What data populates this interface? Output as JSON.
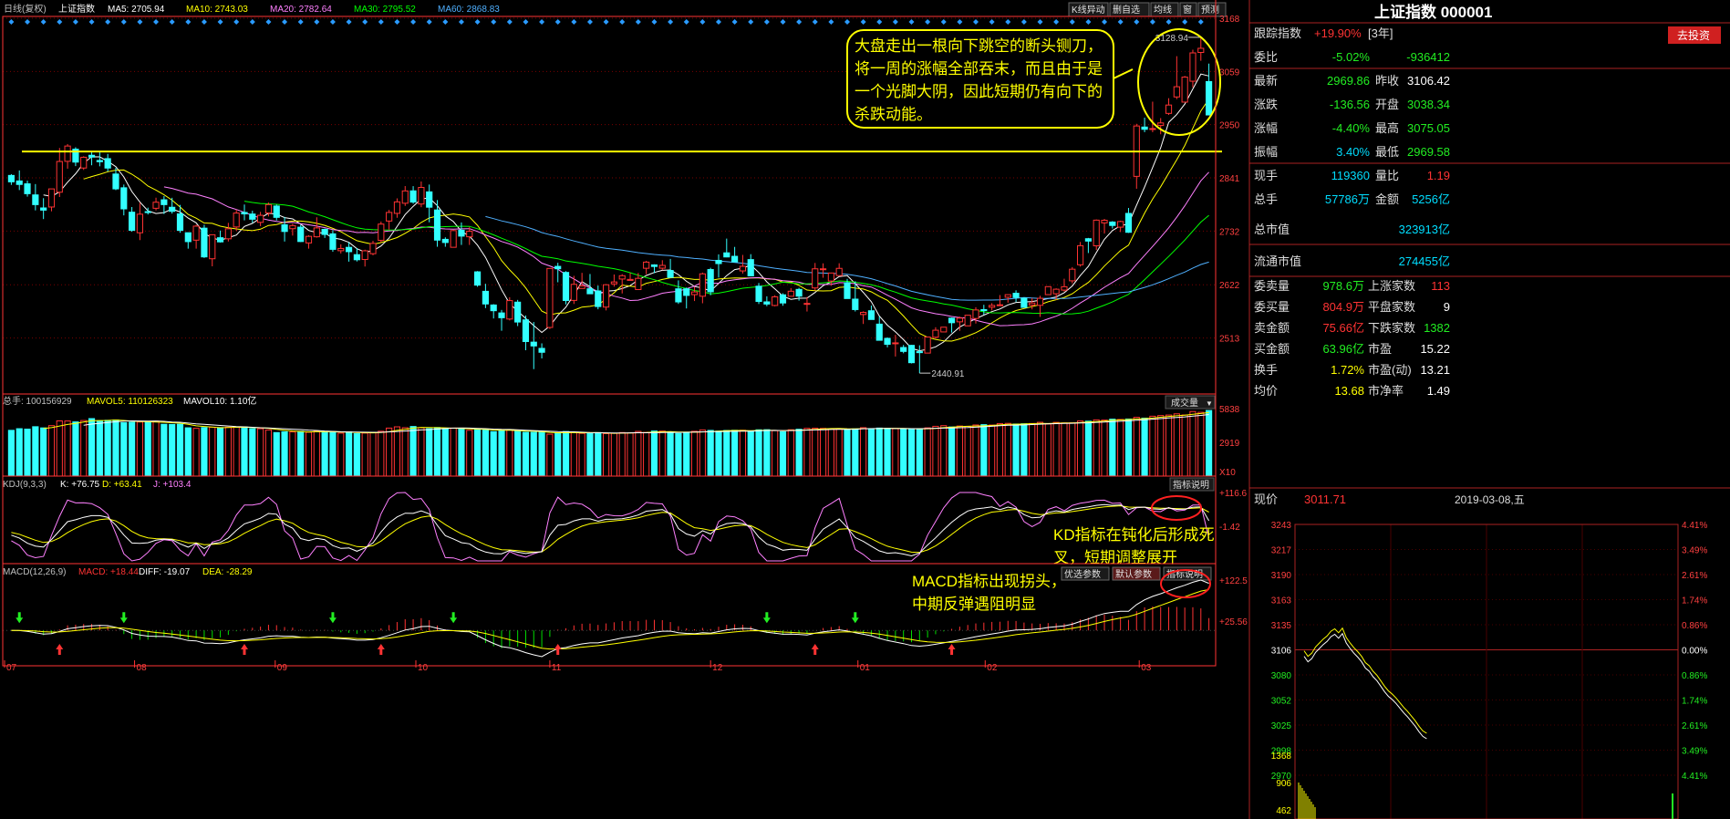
{
  "colors": {
    "up": "#ff3333",
    "down": "#33ffff",
    "ma5": "#ffffff",
    "ma10": "#ffff00",
    "ma20": "#ff80ff",
    "ma30": "#00ff00",
    "ma60": "#4fb0ff",
    "yellow": "#ffff00",
    "grid": "#7a0000",
    "axis": "#ff3333"
  },
  "header": {
    "title": "日线(复权)",
    "name": "上证指数",
    "ma5": "MA5: 2705.94",
    "ma10": "MA10: 2743.03",
    "ma20": "MA20: 2782.64",
    "ma30": "MA30: 2795.52",
    "ma60": "MA60: 2868.83",
    "buttons": [
      "K线异动",
      "删自选",
      "均线",
      "窗",
      "预测"
    ]
  },
  "price_annotation": "大盘走出一根向下跳空的断头铡刀，将一周的涨幅全部吞末，而且由于是一个光脚大阴，因此短期仍有向下的杀跌动能。",
  "kd_annotation": "KD指标在钝化后形成死叉，短期调整展开",
  "macd_annotation": "MACD指标出现拐头，中期反弹遇阻明显",
  "volume_panel": {
    "header": "总手: 100156929",
    "mavol5": "MAVOL5: 110126323",
    "mavol10": "MAVOL10: 1.10亿",
    "button": "成交量",
    "axis": [
      "5838",
      "2919",
      "X10"
    ]
  },
  "kdj_panel": {
    "header": "KDJ(9,3,3)",
    "k": "K: +76.75",
    "d": "D: +63.41",
    "j": "J: +103.4",
    "button": "指标说明",
    "axis": [
      "+116.6",
      "-1.42"
    ]
  },
  "macd_panel": {
    "header": "MACD(12,26,9)",
    "macd": "MACD: +18.44",
    "diff": "DIFF: -19.07",
    "dea": "DEA: -28.29",
    "buttons": [
      "优选参数",
      "默认参数",
      "指标说明"
    ],
    "axis": [
      "+122.5",
      "+25.56"
    ]
  },
  "x_labels": [
    "07",
    "08",
    "09",
    "10",
    "11",
    "12",
    "01",
    "02",
    "03"
  ],
  "right_panel": {
    "title": "上证指数 000001",
    "track_label": "跟踪指数",
    "track_value": "+19.90%",
    "track_period": "[3年]",
    "invest_button": "去投资",
    "rows": [
      [
        "委比",
        "-5.02%",
        "",
        "-936412"
      ],
      [
        "最新",
        "2969.86",
        "昨收",
        "3106.42"
      ],
      [
        "涨跌",
        "-136.56",
        "开盘",
        "3038.34"
      ],
      [
        "涨幅",
        "-4.40%",
        "最高",
        "3075.05"
      ],
      [
        "振幅",
        "3.40%",
        "最低",
        "2969.58"
      ],
      [
        "现手",
        "119360",
        "量比",
        "1.19"
      ],
      [
        "总手",
        "57786万",
        "金额",
        "5256亿"
      ]
    ],
    "cap_rows": [
      [
        "总市值",
        "323913亿"
      ],
      [
        "流通市值",
        "274455亿"
      ]
    ],
    "stat_rows": [
      [
        "委卖量",
        "978.6万",
        "上涨家数",
        "113"
      ],
      [
        "委买量",
        "804.9万",
        "平盘家数",
        "9"
      ],
      [
        "卖金额",
        "75.66亿",
        "下跌家数",
        "1382"
      ],
      [
        "买金额",
        "63.96亿",
        "市盈",
        "15.22"
      ],
      [
        "换手",
        "1.72%",
        "市盈(动)",
        "13.21"
      ],
      [
        "均价",
        "13.68",
        "市净率",
        "1.49"
      ]
    ]
  },
  "intraday": {
    "price_label": "现价",
    "price": "3011.71",
    "date": "2019-03-08,五",
    "left_axis": [
      "3243",
      "3217",
      "3190",
      "3163",
      "3135",
      "3106",
      "3080",
      "3052",
      "3025",
      "2998",
      "2970"
    ],
    "right_axis": [
      "4.41%",
      "3.49%",
      "2.61%",
      "1.74%",
      "0.86%",
      "0.00%",
      "0.86%",
      "1.74%",
      "2.61%",
      "3.49%",
      "4.41%"
    ],
    "vol_axis": [
      "1368",
      "906",
      "462"
    ]
  },
  "chart_data": {
    "type": "candlestick",
    "y_axis": [
      3168,
      3059,
      2950,
      2841,
      2732,
      2622,
      2513
    ],
    "ylim": [
      2402,
      3168
    ],
    "high_label": "3128.94",
    "low_label": "2440.91",
    "support_line": 2895,
    "ma_periods": [
      5,
      10,
      20,
      30,
      60
    ],
    "ohlc": [
      [
        2846.0,
        2848.6,
        2826.6,
        2832.9
      ],
      [
        2834.7,
        2856.2,
        2816.0,
        2827.5
      ],
      [
        2828.8,
        2835.3,
        2802.6,
        2808.6
      ],
      [
        2806.1,
        2828.3,
        2774.4,
        2786.2
      ],
      [
        2779.4,
        2799.4,
        2756.6,
        2774.9
      ],
      [
        2781.3,
        2818.4,
        2772.5,
        2818.4
      ],
      [
        2811.6,
        2902.2,
        2801.8,
        2874.6
      ],
      [
        2874.9,
        2910.3,
        2859.8,
        2906.2
      ],
      [
        2899.8,
        2903.7,
        2865.1,
        2873.3
      ],
      [
        2861.2,
        2885.3,
        2857.3,
        2883.2
      ],
      [
        2887.3,
        2893.3,
        2866.8,
        2883.5
      ],
      [
        2876.6,
        2894.2,
        2864.7,
        2874.1
      ],
      [
        2880.4,
        2890.1,
        2854.1,
        2861.1
      ],
      [
        2848.9,
        2861.8,
        2815.9,
        2818.5
      ],
      [
        2820.7,
        2827.3,
        2764.2,
        2777.5
      ],
      [
        2770.7,
        2781.3,
        2730.6,
        2733.5
      ],
      [
        2728.6,
        2790.3,
        2713.5,
        2766.6
      ],
      [
        2771.8,
        2780.0,
        2766.0,
        2771.5
      ],
      [
        2778.7,
        2800.4,
        2774.4,
        2791.1
      ],
      [
        2796.1,
        2803.6,
        2767.0,
        2786.2
      ],
      [
        2780.8,
        2800.2,
        2767.8,
        2772.4
      ],
      [
        2767.3,
        2785.6,
        2728.6,
        2733.4
      ],
      [
        2728.6,
        2727.2,
        2696.0,
        2710.4
      ],
      [
        2713.4,
        2745.2,
        2696.0,
        2742.1
      ],
      [
        2738.0,
        2745.0,
        2677.0,
        2679.1
      ],
      [
        2675.3,
        2724.9,
        2659.8,
        2724.5
      ],
      [
        2718.4,
        2733.1,
        2708.5,
        2709.9
      ],
      [
        2716.2,
        2748.8,
        2710.7,
        2736.7
      ],
      [
        2740.4,
        2776.0,
        2732.6,
        2768.9
      ],
      [
        2770.2,
        2786.4,
        2754.0,
        2767.2
      ],
      [
        2766.9,
        2773.7,
        2748.8,
        2756.3
      ],
      [
        2749.9,
        2771.3,
        2742.1,
        2764.3
      ],
      [
        2769.1,
        2790.5,
        2762.0,
        2786.2
      ],
      [
        2783.3,
        2786.4,
        2753.8,
        2760.1
      ],
      [
        2744.9,
        2761.0,
        2710.6,
        2731.2
      ],
      [
        2736.9,
        2747.0,
        2722.8,
        2743.3
      ],
      [
        2740.0,
        2744.8,
        2709.6,
        2710.6
      ],
      [
        2707.7,
        2723.3,
        2696.0,
        2721.2
      ],
      [
        2720.3,
        2760.3,
        2718.6,
        2738.5
      ],
      [
        2735.5,
        2737.2,
        2718.0,
        2725.1
      ],
      [
        2726.3,
        2733.7,
        2689.7,
        2694.6
      ],
      [
        2691.8,
        2704.9,
        2686.1,
        2696.4
      ],
      [
        2698.7,
        2709.1,
        2669.4,
        2689.8
      ],
      [
        2683.7,
        2697.2,
        2669.7,
        2673.3
      ],
      [
        2673.8,
        2693.9,
        2659.4,
        2691.6
      ],
      [
        2685.7,
        2712.1,
        2682.4,
        2706.8
      ],
      [
        2713.0,
        2751.5,
        2709.0,
        2746.3
      ],
      [
        2752.6,
        2775.4,
        2735.0,
        2770.2
      ],
      [
        2768.3,
        2799.0,
        2759.3,
        2791.8
      ],
      [
        2789.0,
        2824.2,
        2783.5,
        2814.3
      ],
      [
        2814.4,
        2824.0,
        2788.0,
        2791.4
      ],
      [
        2787.5,
        2833.6,
        2780.9,
        2821.4
      ],
      [
        2812.3,
        2827.3,
        2750.0,
        2780.9
      ],
      [
        2775.3,
        2795.5,
        2699.9,
        2713.5
      ],
      [
        2715.1,
        2719.2,
        2699.9,
        2708.6
      ],
      [
        2698.8,
        2734.5,
        2699.0,
        2733.0
      ],
      [
        2733.8,
        2749.7,
        2703.6,
        2721.7
      ],
      [
        2720.3,
        2740.0,
        2703.6,
        2731.6
      ],
      [
        2648.5,
        2650.1,
        2617.9,
        2621.3
      ],
      [
        2608.6,
        2624.0,
        2574.2,
        2582.7
      ],
      [
        2580.6,
        2582.3,
        2553.0,
        2568.9
      ],
      [
        2564.3,
        2570.5,
        2527.8,
        2554.5
      ],
      [
        2551.8,
        2596.5,
        2549.0,
        2589.6
      ],
      [
        2586.4,
        2591.0,
        2537.4,
        2545.7
      ],
      [
        2550.1,
        2559.1,
        2487.9,
        2505.7
      ],
      [
        2504.5,
        2545.7,
        2449.2,
        2496.7
      ],
      [
        2491.7,
        2502.0,
        2471.1,
        2483.7
      ],
      [
        2534.6,
        2655.5,
        2531.5,
        2655.5
      ],
      [
        2659.7,
        2667.0,
        2627.1,
        2654.8
      ],
      [
        2647.3,
        2649.9,
        2581.7,
        2589.8
      ],
      [
        2590.0,
        2640.2,
        2582.7,
        2622.9
      ],
      [
        2614.5,
        2646.4,
        2614.5,
        2619.6
      ],
      [
        2613.8,
        2644.1,
        2603.0,
        2603.6
      ],
      [
        2609.4,
        2620.4,
        2571.8,
        2577.4
      ],
      [
        2576.3,
        2623.5,
        2569.5,
        2622.0
      ],
      [
        2623.9,
        2643.1,
        2618.2,
        2627.8
      ],
      [
        2633.8,
        2643.7,
        2604.2,
        2640.6
      ],
      [
        2631.0,
        2646.2,
        2633.0,
        2633.0
      ],
      [
        2612.2,
        2646.2,
        2611.7,
        2635.2
      ],
      [
        2655.8,
        2670.9,
        2643.6,
        2668.4
      ],
      [
        2662.7,
        2664.0,
        2645.8,
        2659.5
      ],
      [
        2656.0,
        2672.3,
        2652.0,
        2661.7
      ],
      [
        2651.3,
        2675.0,
        2636.7,
        2637.2
      ],
      [
        2613.7,
        2631.0,
        2582.8,
        2586.9
      ],
      [
        2613.6,
        2616.4,
        2573.5,
        2600.2
      ],
      [
        2601.8,
        2617.6,
        2588.7,
        2607.3
      ],
      [
        2598.5,
        2647.0,
        2584.1,
        2644.4
      ],
      [
        2653.2,
        2656.8,
        2600.6,
        2607.6
      ],
      [
        2672.0,
        2684.3,
        2636.8,
        2665.4
      ],
      [
        2687.4,
        2716.6,
        2678.3,
        2679.0
      ],
      [
        2680.3,
        2699.6,
        2669.0,
        2669.0
      ],
      [
        2650.4,
        2683.2,
        2645.0,
        2659.8
      ],
      [
        2673.6,
        2684.7,
        2640.2,
        2640.2
      ],
      [
        2619.1,
        2625.7,
        2582.6,
        2587.8
      ],
      [
        2587.0,
        2598.4,
        2578.1,
        2582.5
      ],
      [
        2579.6,
        2600.6,
        2577.8,
        2597.3
      ],
      [
        2601.4,
        2604.5,
        2579.0,
        2584.7
      ],
      [
        2598.4,
        2615.2,
        2598.9,
        2608.8
      ],
      [
        2612.5,
        2615.8,
        2589.5,
        2598.7
      ],
      [
        2583.6,
        2597.0,
        2567.2,
        2583.8
      ],
      [
        2615.5,
        2666.7,
        2610.2,
        2654.7
      ],
      [
        2654.0,
        2665.9,
        2636.4,
        2654.7
      ],
      [
        2629.7,
        2646.9,
        2619.9,
        2646.1
      ],
      [
        2640.8,
        2666.1,
        2640.7,
        2655.6
      ],
      [
        2626.3,
        2634.1,
        2593.8,
        2593.8
      ],
      [
        2592.6,
        2629.3,
        2567.3,
        2571.2
      ],
      [
        2561.1,
        2567.6,
        2541.7,
        2565.4
      ],
      [
        2568.8,
        2579.5,
        2550.9,
        2550.9
      ],
      [
        2541.4,
        2557.2,
        2508.3,
        2508.3
      ],
      [
        2512.2,
        2514.1,
        2493.8,
        2500.1
      ],
      [
        2502.4,
        2519.4,
        2475.0,
        2503.0
      ],
      [
        2493.5,
        2498.7,
        2481.7,
        2485.5
      ],
      [
        2497.9,
        2498.7,
        2460.9,
        2462.4
      ],
      [
        2485.0,
        2498.0,
        2441.0,
        2483.0
      ],
      [
        2482.1,
        2515.3,
        2481.8,
        2514.9
      ],
      [
        2514.5,
        2535.0,
        2512.0,
        2528.9
      ],
      [
        2525.4,
        2535.6,
        2534.9,
        2535.1
      ],
      [
        2553.6,
        2554.8,
        2524.1,
        2544.3
      ],
      [
        2546.1,
        2556.8,
        2527.7,
        2553.8
      ],
      [
        2537.9,
        2557.6,
        2542.1,
        2559.6
      ],
      [
        2553.0,
        2576.0,
        2542.6,
        2570.4
      ],
      [
        2571.1,
        2581.0,
        2560.5,
        2570.9
      ],
      [
        2576.0,
        2584.4,
        2569.6,
        2579.7
      ],
      [
        2579.9,
        2601.0,
        2579.0,
        2581.0
      ],
      [
        2596.5,
        2601.6,
        2585.3,
        2601.7
      ],
      [
        2604.6,
        2610.6,
        2586.7,
        2596.0
      ],
      [
        2594.5,
        2596.4,
        2575.6,
        2575.6
      ],
      [
        2580.3,
        2594.9,
        2571.6,
        2584.6
      ],
      [
        2579.9,
        2599.5,
        2556.2,
        2594.3
      ],
      [
        2601.8,
        2618.9,
        2601.2,
        2618.2
      ],
      [
        2603.6,
        2614.7,
        2590.6,
        2612.9
      ],
      [
        2611.1,
        2634.4,
        2608.0,
        2618.0
      ],
      [
        2630.1,
        2658.2,
        2624.9,
        2653.9
      ],
      [
        2663.0,
        2709.7,
        2659.2,
        2702.1
      ],
      [
        2716.4,
        2718.0,
        2687.0,
        2711.5
      ],
      [
        2701.8,
        2755.8,
        2693.0,
        2754.4
      ],
      [
        2748.8,
        2757.0,
        2726.9,
        2754.1
      ],
      [
        2750.5,
        2752.4,
        2737.3,
        2743.5
      ],
      [
        2740.0,
        2753.3,
        2730.0,
        2751.6
      ],
      [
        2768.2,
        2779.4,
        2728.2,
        2729.5
      ],
      [
        2844.1,
        2951.7,
        2818.7,
        2947.3
      ],
      [
        2945.1,
        2964.4,
        2934.6,
        2940.5
      ],
      [
        2941.2,
        2997.1,
        2934.6,
        2942.0
      ],
      [
        2948.3,
        2963.4,
        2930.3,
        2953.5
      ],
      [
        2973.1,
        3004.2,
        2969.9,
        2990.2
      ],
      [
        3006.8,
        3090.3,
        3002.2,
        3027.7
      ],
      [
        2996.2,
        3049.8,
        3009.0,
        3047.4
      ],
      [
        3039.0,
        3103.6,
        3026.5,
        3097.0
      ],
      [
        3097.9,
        3128.9,
        3080.9,
        3106.4
      ],
      [
        3038.3,
        3075.1,
        2969.6,
        2969.9
      ]
    ],
    "volume": [
      1423,
      1474,
      1461,
      1536,
      1499,
      1570,
      1718,
      1714,
      1686,
      1728,
      1788,
      1723,
      1735,
      1747,
      1662,
      1674,
      1683,
      1689,
      1711,
      1611,
      1606,
      1612,
      1502,
      1485,
      1510,
      1519,
      1509,
      1522,
      1526,
      1530,
      1475,
      1473,
      1435,
      1354,
      1380,
      1374,
      1392,
      1364,
      1402,
      1362,
      1383,
      1335,
      1375,
      1320,
      1338,
      1355,
      1395,
      1493,
      1532,
      1505,
      1543,
      1504,
      1474,
      1510,
      1468,
      1493,
      1462,
      1425,
      1460,
      1431,
      1384,
      1428,
      1440,
      1402,
      1362,
      1363,
      1361,
      1303,
      1347,
      1386,
      1361,
      1330,
      1325,
      1354,
      1322,
      1330,
      1354,
      1343,
      1390,
      1358,
      1402,
      1400,
      1371,
      1325,
      1341,
      1394,
      1435,
      1421,
      1398,
      1419,
      1425,
      1426,
      1389,
      1440,
      1443,
      1414,
      1377,
      1441,
      1457,
      1485,
      1490,
      1484,
      1474,
      1470,
      1453,
      1469,
      1506,
      1477,
      1494,
      1486,
      1479,
      1468,
      1450,
      1462,
      1500,
      1548,
      1569,
      1528,
      1557,
      1547,
      1590,
      1600,
      1587,
      1634,
      1640,
      1619,
      1628,
      1636,
      1673,
      1621,
      1671,
      1654,
      1656,
      1714,
      1708,
      1749,
      1742,
      1771,
      1762,
      1775,
      1828,
      1803,
      1862,
      1883,
      1899,
      1936,
      1901,
      2008,
      1983,
      2041
    ],
    "kdj": {
      "k_last": 76.75,
      "d_last": 63.41,
      "j_last": 103.4,
      "ylim": [
        -1.42,
        116.6
      ]
    },
    "macd": {
      "macd_last": 18.44,
      "diff_last": -19.07,
      "dea_last": -28.29
    }
  }
}
